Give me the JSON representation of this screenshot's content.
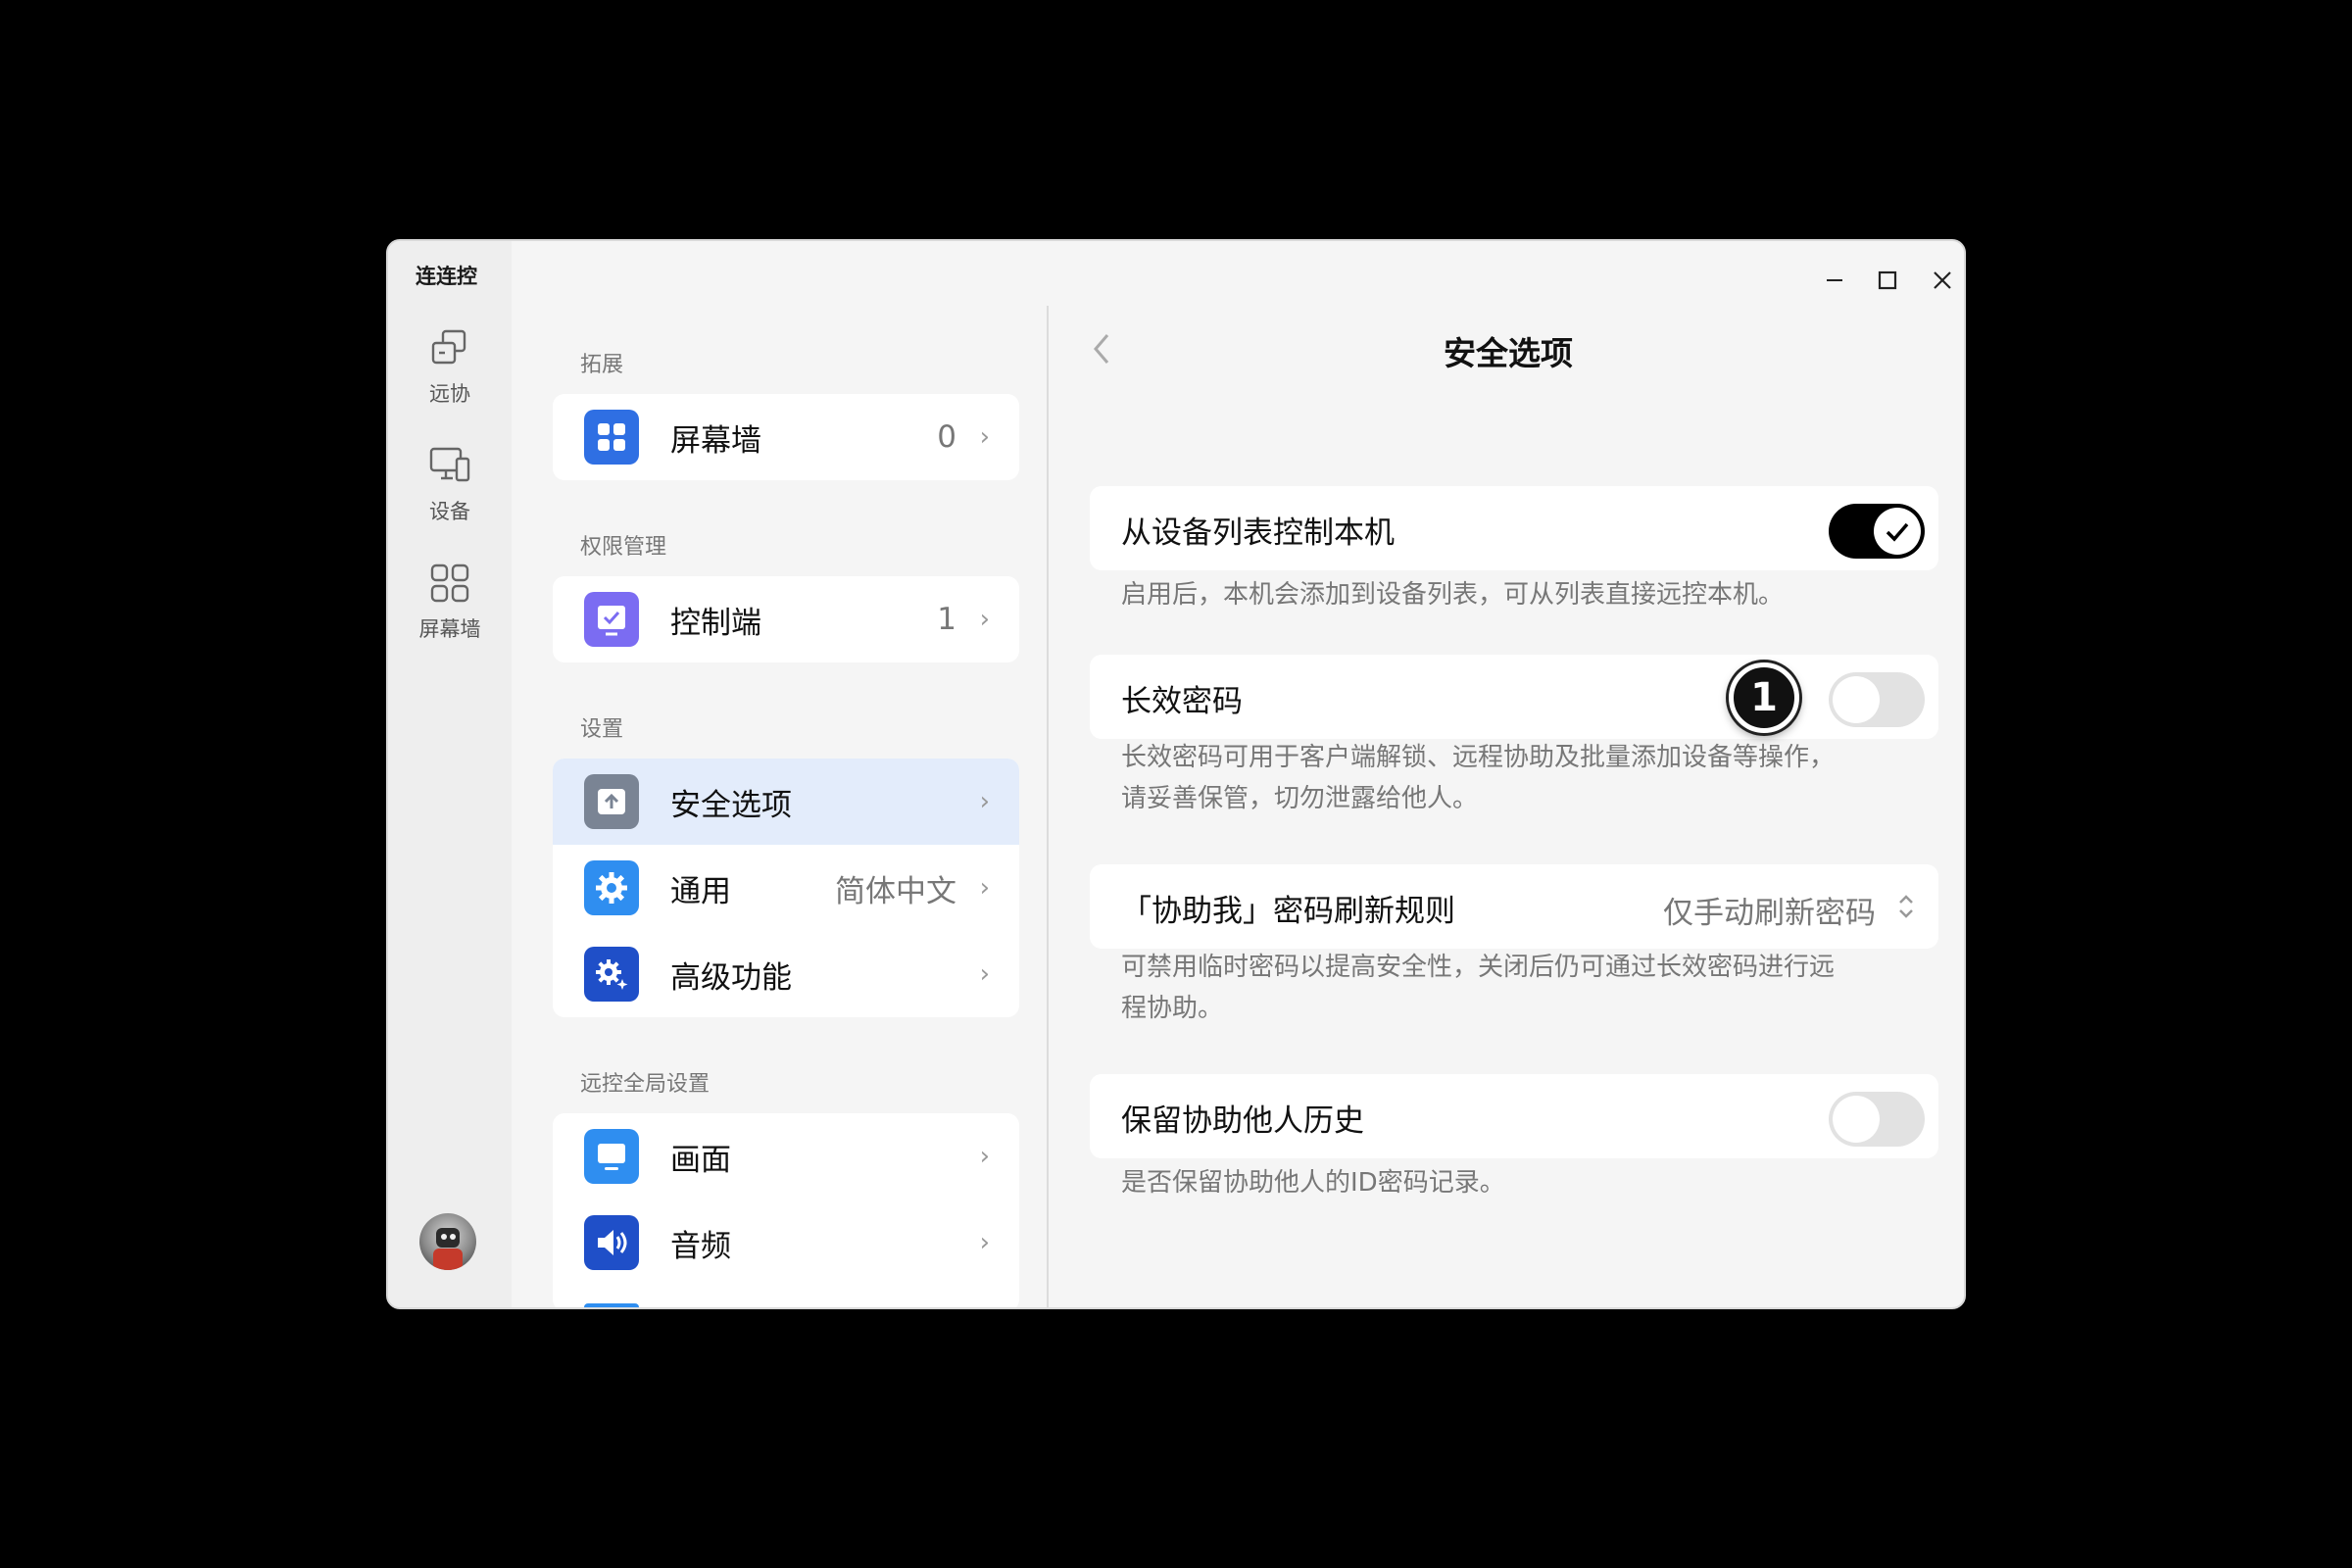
{
  "app": {
    "title": "连连控"
  },
  "rail": {
    "items": [
      {
        "label": "远协",
        "icon": "remote-assist-icon"
      },
      {
        "label": "设备",
        "icon": "devices-icon"
      },
      {
        "label": "屏幕墙",
        "icon": "screen-wall-icon"
      }
    ]
  },
  "mid": {
    "sections": [
      {
        "label": "拓展"
      },
      {
        "label": "权限管理"
      },
      {
        "label": "设置"
      },
      {
        "label": "远控全局设置"
      }
    ],
    "ext": {
      "label": "屏幕墙",
      "value": "0",
      "icon": "grid-icon"
    },
    "perm": {
      "label": "控制端",
      "value": "1",
      "icon": "check-screen-icon"
    },
    "settings": [
      {
        "label": "安全选项",
        "value": "",
        "icon": "shield-upload-icon",
        "active": true
      },
      {
        "label": "通用",
        "value": "简体中文",
        "icon": "gear-icon"
      },
      {
        "label": "高级功能",
        "value": "",
        "icon": "advanced-gear-icon"
      }
    ],
    "global": [
      {
        "label": "画面",
        "icon": "monitor-icon"
      },
      {
        "label": "音频",
        "icon": "speaker-icon"
      }
    ]
  },
  "page": {
    "title": "安全选项",
    "options": [
      {
        "label": "从设备列表控制本机",
        "toggle": true,
        "desc": "启用后，本机会添加到设备列表，可从列表直接远控本机。"
      },
      {
        "label": "长效密码",
        "toggle": false,
        "desc_line1": "长效密码可用于客户端解锁、远程协助及批量添加设备等操作，",
        "desc_line2": "请妥善保管，切勿泄露给他人。"
      },
      {
        "label": "「协助我」密码刷新规则",
        "select_value": "仅手动刷新密码",
        "desc_line1": "可禁用临时密码以提高安全性，关闭后仍可通过长效密码进行远",
        "desc_line2": "程协助。"
      },
      {
        "label": "保留协助他人历史",
        "toggle": false,
        "desc": "是否保留协助他人的ID密码记录。"
      }
    ]
  },
  "marker": {
    "label": "1"
  },
  "colors": {
    "accent": "#2f6fe3",
    "active_row": "#e3ecfb",
    "toggle_on": "#000000",
    "toggle_off": "#e2e2e2"
  }
}
